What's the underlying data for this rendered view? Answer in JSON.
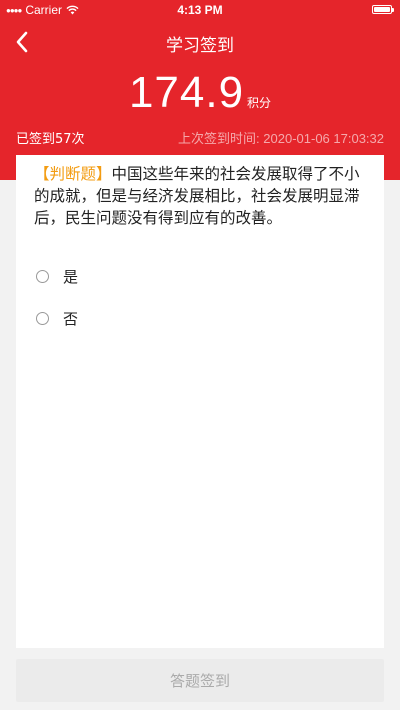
{
  "status_bar": {
    "carrier": "Carrier",
    "time": "4:13 PM"
  },
  "nav": {
    "title": "学习签到",
    "back_icon": "chevron-left-icon"
  },
  "score": {
    "value": "174.9",
    "unit": "积分"
  },
  "info": {
    "signed_count": "已签到57次",
    "last_sign_label": "上次签到时间:",
    "last_sign_time": "2020-01-06 17:03:32"
  },
  "question": {
    "tag": "【判断题】",
    "text": "中国这些年来的社会发展取得了不小的成就，但是与经济发展相比，社会发展明显滞后，民生问题没有得到应有的改善。",
    "options": [
      {
        "label": "是"
      },
      {
        "label": "否"
      }
    ]
  },
  "submit": {
    "label": "答题签到"
  },
  "colors": {
    "primary": "#e5252b",
    "tag": "#f39c12",
    "background": "#f2f2f2",
    "disabled_button": "#ebebeb"
  }
}
